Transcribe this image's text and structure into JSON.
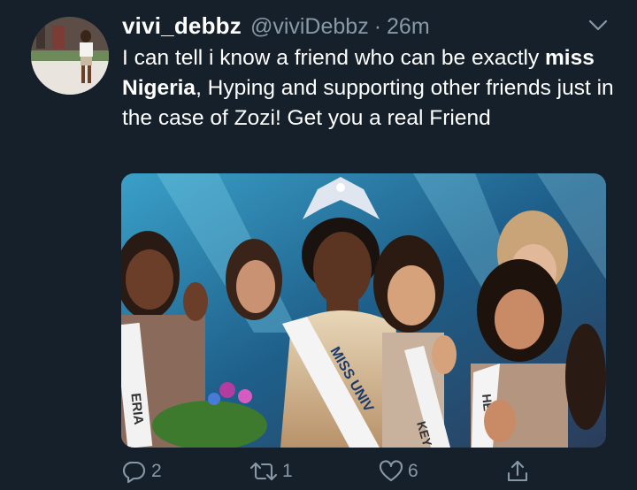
{
  "tweet": {
    "display_name": "vivi_debbz",
    "handle": "@viviDebbz",
    "separator": "·",
    "time": "26m",
    "text_part1": "I can tell i know a friend who can be  exactly ",
    "text_bold": "miss Nigeria",
    "text_part2": ", Hyping and supporting other friends just in the case of Zozi! Get you a real Friend",
    "media_sash_text": "MISS UNIV",
    "media_sash_left": "ERIA",
    "media_sash_right1": "HE",
    "media_sash_right2": "KEY"
  },
  "actions": {
    "reply_count": "2",
    "retweet_count": "1",
    "like_count": "6"
  },
  "icons": {
    "chevron": "chevron-down-icon",
    "reply": "reply-icon",
    "retweet": "retweet-icon",
    "like": "heart-icon",
    "share": "share-icon"
  },
  "colors": {
    "background": "#15202b",
    "secondary_text": "#8899a6",
    "primary_text": "#ffffff"
  }
}
